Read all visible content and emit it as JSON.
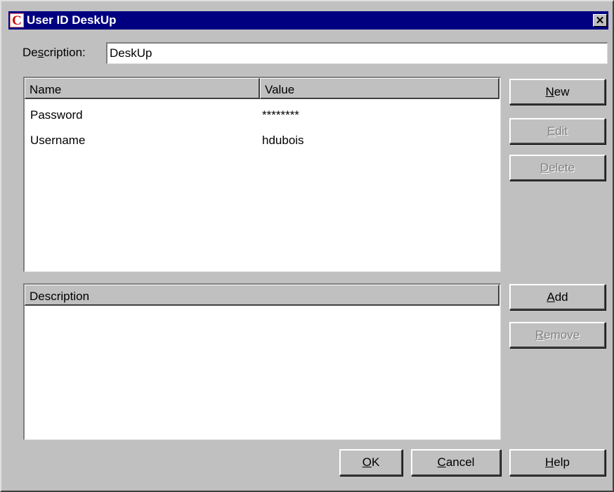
{
  "dialog": {
    "title": "User ID DeskUp",
    "icon": "app-logo-c-icon",
    "close_icon": "close-icon"
  },
  "description": {
    "label_pre": "De",
    "label_key": "s",
    "label_post": "cription:",
    "value": "DeskUp"
  },
  "fields_table": {
    "columns": [
      "Name",
      "Value"
    ],
    "rows": [
      {
        "name": "Password",
        "value": "********"
      },
      {
        "name": "Username",
        "value": "hdubois"
      }
    ]
  },
  "description_table": {
    "columns": [
      "Description"
    ],
    "rows": []
  },
  "buttons": {
    "new": {
      "key": "N",
      "rest": "ew",
      "enabled": true
    },
    "edit": {
      "key": "E",
      "rest": "dit",
      "enabled": false
    },
    "delete": {
      "key": "D",
      "rest": "elete",
      "enabled": false
    },
    "add": {
      "key": "A",
      "rest": "dd",
      "enabled": true
    },
    "remove": {
      "key": "R",
      "rest": "emove",
      "enabled": false
    },
    "ok": {
      "key": "O",
      "rest": "K",
      "enabled": true
    },
    "cancel": {
      "key": "C",
      "rest": "ancel",
      "enabled": true
    },
    "help": {
      "key": "H",
      "rest": "elp",
      "enabled": true
    }
  }
}
